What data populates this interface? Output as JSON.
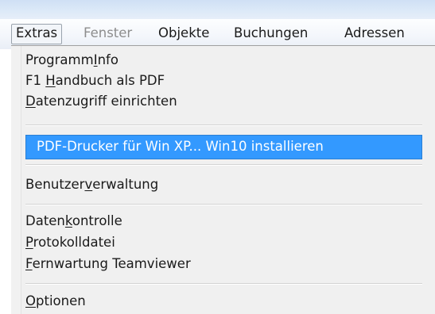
{
  "menubar": {
    "items": [
      {
        "label": "Extras",
        "state": "active"
      },
      {
        "label": "Fenster",
        "state": "disabled"
      },
      {
        "label": "Objekte",
        "state": "normal"
      },
      {
        "label": "Buchungen",
        "state": "normal"
      },
      {
        "label": "Adressen",
        "state": "normal"
      }
    ]
  },
  "dropdown": {
    "items": [
      {
        "pre": "Programm",
        "u": "I",
        "post": "nfo"
      },
      {
        "pre": "F1 ",
        "u": "H",
        "post": "andbuch als PDF"
      },
      {
        "pre": "",
        "u": "D",
        "post": "atenzugriff einrichten"
      },
      {
        "label": "PDF-Drucker für Win XP... Win10 installieren",
        "highlighted": true
      },
      {
        "pre": "Benutzer",
        "u": "v",
        "post": "erwaltung"
      },
      {
        "pre": "Daten",
        "u": "k",
        "post": "ontrolle"
      },
      {
        "pre": "",
        "u": "P",
        "post": "rotokolldatei"
      },
      {
        "pre": "",
        "u": "F",
        "post": "ernwartung Teamviewer"
      },
      {
        "pre": "",
        "u": "O",
        "post": "ptionen"
      }
    ]
  },
  "colors": {
    "highlight": "#3399ff",
    "menu_background": "#f0f0f0",
    "disabled_text": "#8d8d8d"
  }
}
